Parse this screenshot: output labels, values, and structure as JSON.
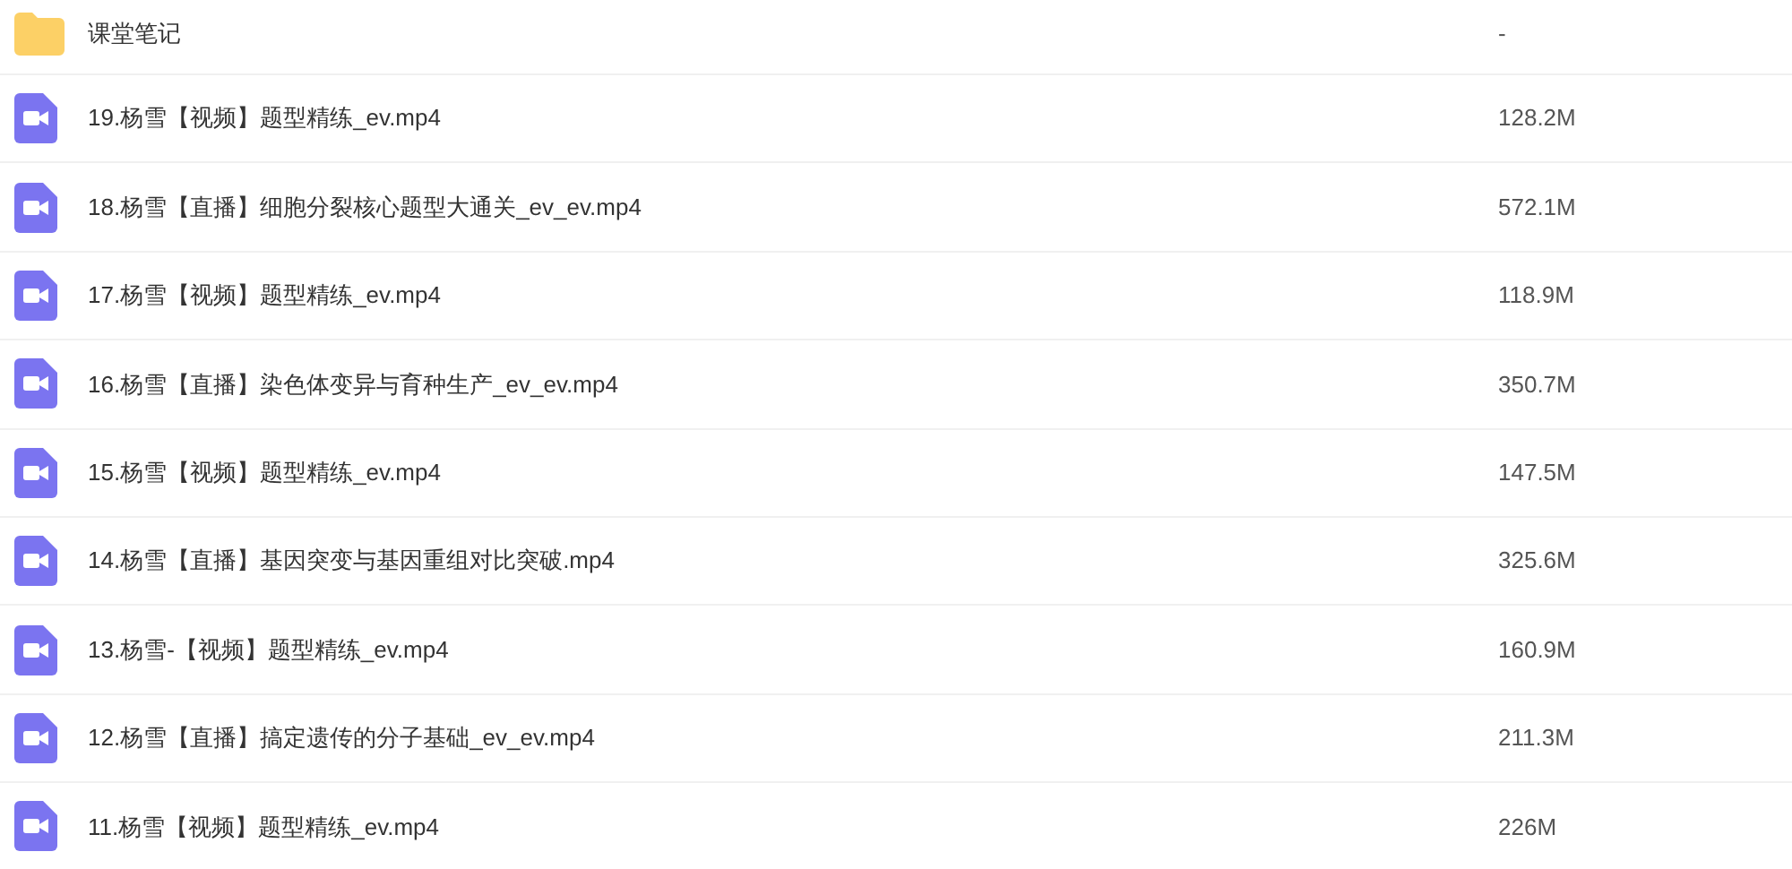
{
  "files": [
    {
      "kind": "folder",
      "name": "课堂笔记",
      "size": "-"
    },
    {
      "kind": "video",
      "name": "19.杨雪【视频】题型精练_ev.mp4",
      "size": "128.2M"
    },
    {
      "kind": "video",
      "name": "18.杨雪【直播】细胞分裂核心题型大通关_ev_ev.mp4",
      "size": "572.1M"
    },
    {
      "kind": "video",
      "name": "17.杨雪【视频】题型精练_ev.mp4",
      "size": "118.9M"
    },
    {
      "kind": "video",
      "name": "16.杨雪【直播】染色体变异与育种生产_ev_ev.mp4",
      "size": "350.7M"
    },
    {
      "kind": "video",
      "name": "15.杨雪【视频】题型精练_ev.mp4",
      "size": "147.5M"
    },
    {
      "kind": "video",
      "name": "14.杨雪【直播】基因突变与基因重组对比突破.mp4",
      "size": "325.6M"
    },
    {
      "kind": "video",
      "name": "13.杨雪-【视频】题型精练_ev.mp4",
      "size": "160.9M"
    },
    {
      "kind": "video",
      "name": "12.杨雪【直播】搞定遗传的分子基础_ev_ev.mp4",
      "size": "211.3M"
    },
    {
      "kind": "video",
      "name": "11.杨雪【视频】题型精练_ev.mp4",
      "size": "226M"
    }
  ]
}
